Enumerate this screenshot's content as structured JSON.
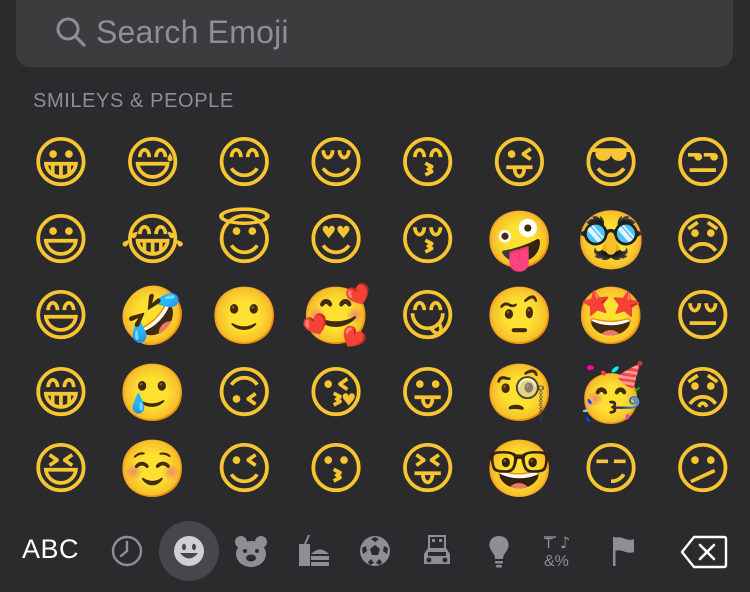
{
  "search": {
    "placeholder": "Search Emoji",
    "icon": "magnifier"
  },
  "section": {
    "title": "SMILEYS & PEOPLE"
  },
  "emoji_grid": [
    [
      "😀",
      "😅",
      "😊",
      "😌",
      "😙",
      "😜",
      "😎",
      "😒"
    ],
    [
      "😃",
      "😂",
      "😇",
      "😍",
      "😚",
      "🤪",
      "🥸",
      "😞"
    ],
    [
      "😄",
      "🤣",
      "🙂",
      "🥰",
      "😋",
      "🤨",
      "🤩",
      "😔"
    ],
    [
      "😁",
      "🥲",
      "🙃",
      "😘",
      "😛",
      "🧐",
      "🥳",
      "😟"
    ],
    [
      "😆",
      "☺️",
      "😉",
      "😗",
      "😝",
      "🤓",
      "😏",
      "😕"
    ]
  ],
  "bottom_bar": {
    "abc_label": "ABC",
    "categories": [
      "recent",
      "smileys",
      "animals",
      "food",
      "activity",
      "travel",
      "objects",
      "symbols",
      "flags"
    ],
    "active_category": "smileys"
  },
  "colors": {
    "background": "#2b2b2d",
    "search_bg": "#3c3c3f",
    "muted_text": "#8e8e93",
    "active_bg": "#47474b"
  }
}
